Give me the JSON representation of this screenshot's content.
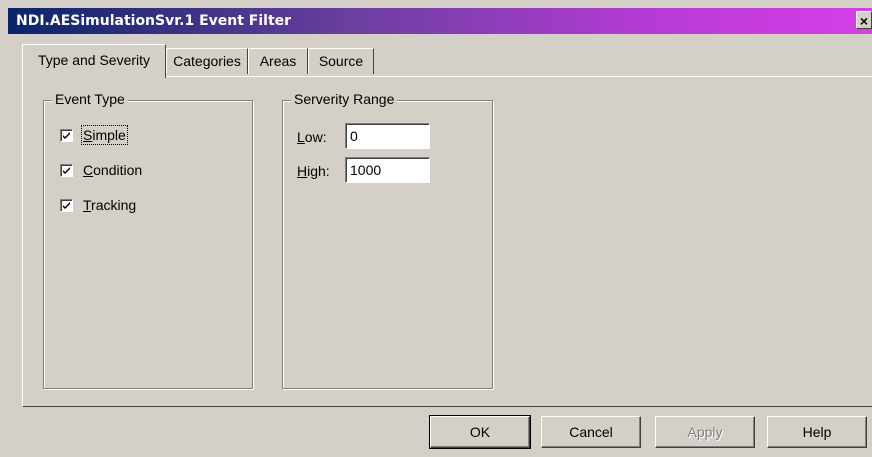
{
  "window": {
    "title": "NDI.AESimulationSvr.1 Event Filter",
    "close_glyph": "×"
  },
  "tabs": [
    {
      "label": "Type and Severity",
      "active": true
    },
    {
      "label": "Categories",
      "active": false
    },
    {
      "label": "Areas",
      "active": false
    },
    {
      "label": "Source",
      "active": false
    }
  ],
  "event_type": {
    "legend": "Event Type",
    "items": [
      {
        "accel": "S",
        "rest": "imple",
        "checked": true
      },
      {
        "accel": "C",
        "rest": "ondition",
        "checked": true
      },
      {
        "accel": "T",
        "rest": "racking",
        "checked": true
      }
    ]
  },
  "severity": {
    "legend": "Serverity Range",
    "low_accel": "L",
    "low_rest": "ow:",
    "low_value": "0",
    "high_accel": "H",
    "high_rest": "igh:",
    "high_value": "1000"
  },
  "buttons": {
    "ok": "OK",
    "cancel": "Cancel",
    "apply": "Apply",
    "help": "Help"
  }
}
